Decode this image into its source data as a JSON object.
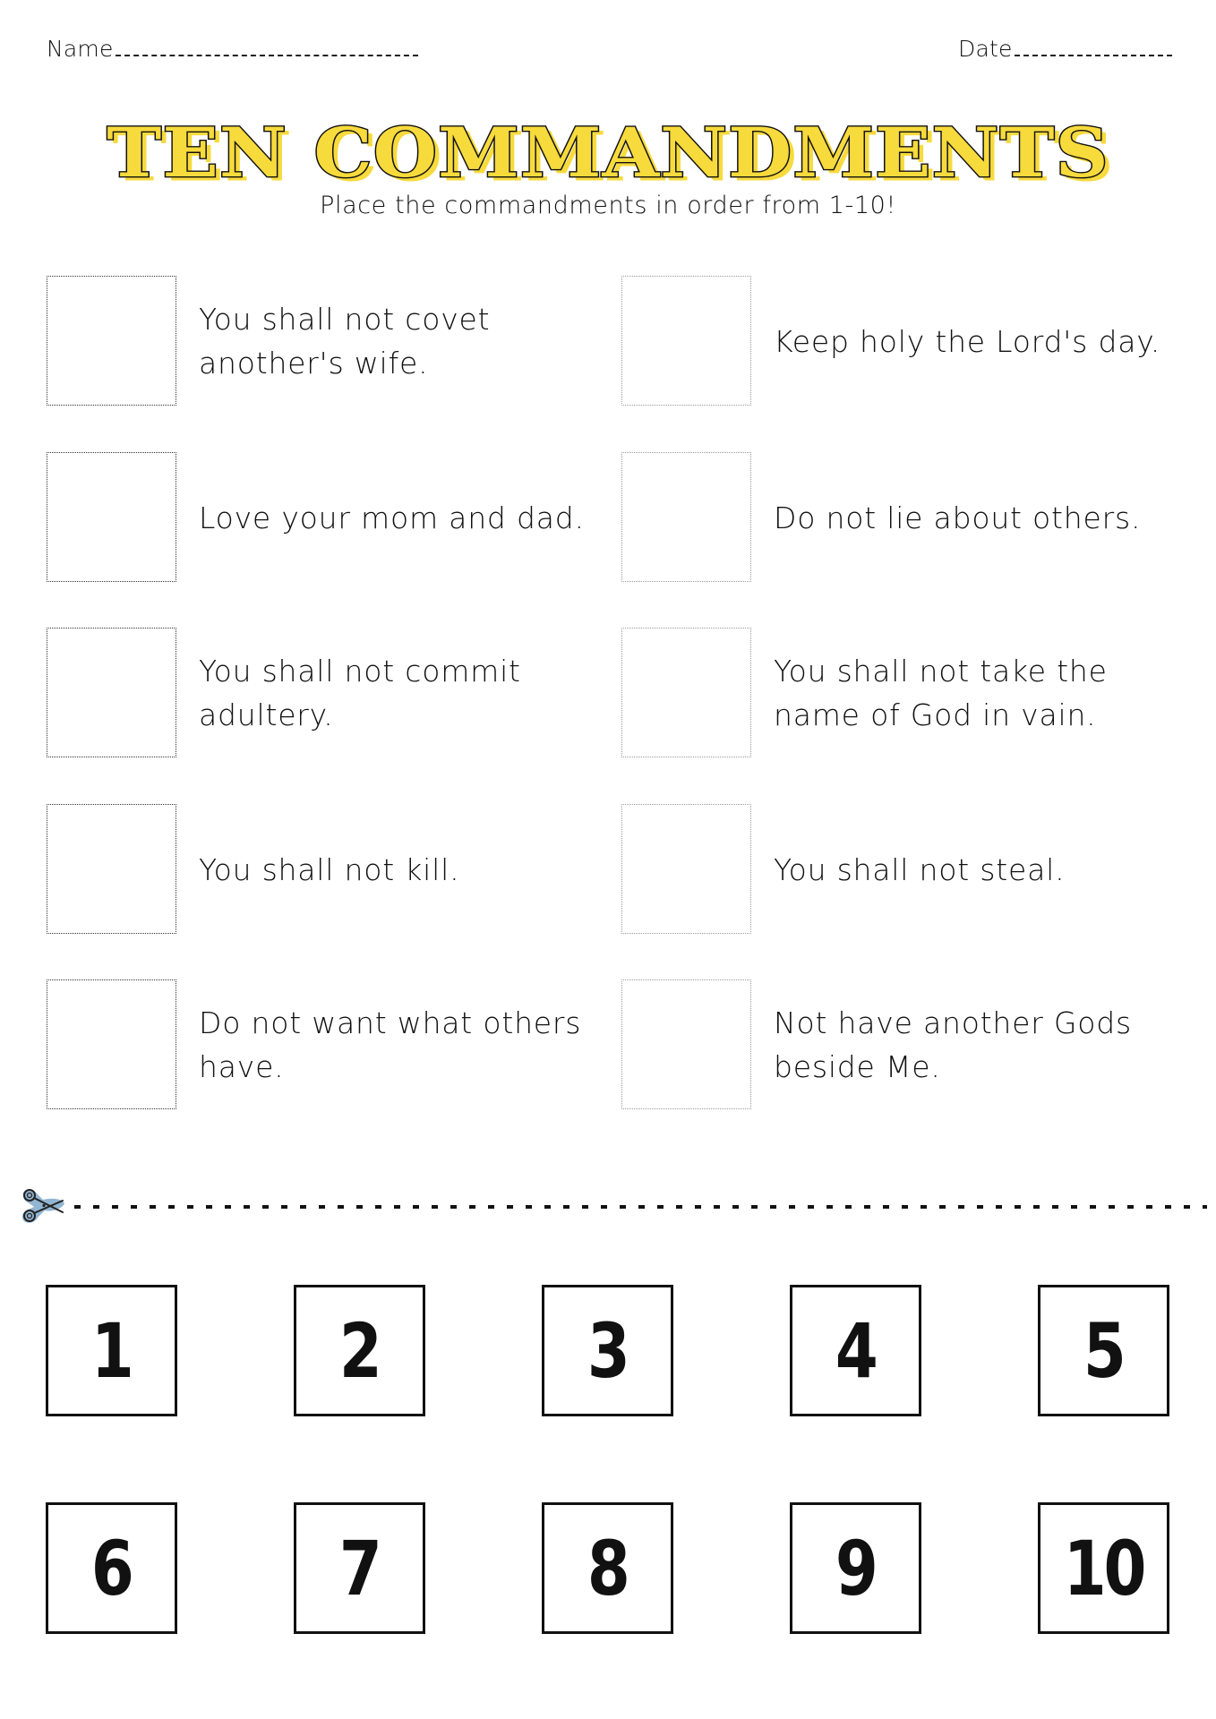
{
  "header": {
    "name_label": "Name",
    "date_label": "Date"
  },
  "title": "TEN COMMANDMENTS",
  "subtitle": "Place the commandments in order from 1-10!",
  "colors": {
    "title_fill": "#F7DA3C",
    "title_outline": "#111111",
    "scissors_highlight": "#7FA8C9"
  },
  "commandments": [
    {
      "text": "You shall not covet another's wife.",
      "column": "left"
    },
    {
      "text": "Keep holy the Lord's day.",
      "column": "right"
    },
    {
      "text": "Love your mom and dad.",
      "column": "left"
    },
    {
      "text": "Do not lie about others.",
      "column": "right"
    },
    {
      "text": "You shall not commit adultery.",
      "column": "left"
    },
    {
      "text": "You shall not take the name of God in vain.",
      "column": "right"
    },
    {
      "text": "You shall not kill.",
      "column": "left"
    },
    {
      "text": "You shall not steal.",
      "column": "right"
    },
    {
      "text": "Do not want what others have.",
      "column": "left"
    },
    {
      "text": "Not have another Gods beside Me.",
      "column": "right"
    }
  ],
  "cut_line": {
    "icon": "scissors-icon"
  },
  "number_cards": [
    "1",
    "2",
    "3",
    "4",
    "5",
    "6",
    "7",
    "8",
    "9",
    "10"
  ]
}
